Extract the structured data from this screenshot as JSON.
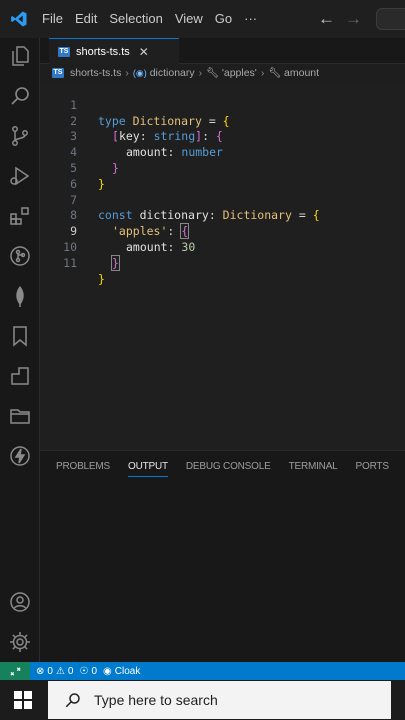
{
  "titlebar": {
    "menu": [
      "File",
      "Edit",
      "Selection",
      "View",
      "Go",
      "···"
    ],
    "back_icon": "arrow-left-icon",
    "forward_icon": "arrow-right-icon"
  },
  "activitybar": {
    "icons": [
      "files-icon",
      "search-icon",
      "source-control-icon",
      "run-debug-icon",
      "extensions-icon",
      "github-icon",
      "mongodb-leaf-icon",
      "bookmark-icon",
      "page-icon",
      "folder-icon",
      "lightning-icon",
      "account-icon",
      "settings-gear-icon"
    ]
  },
  "tab": {
    "label": "shorts-ts.ts",
    "badge": "TS",
    "close": "✕"
  },
  "breadcrumb": {
    "file": "shorts-ts.ts",
    "symbol": "dictionary",
    "key1": "'apples'",
    "key2": "amount"
  },
  "code": {
    "line_numbers": [
      "1",
      "2",
      "3",
      "4",
      "5",
      "6",
      "7",
      "8",
      "9",
      "10",
      "11"
    ],
    "active_line": 9,
    "tokens": {
      "type_kw": "type",
      "dict_type": "Dictionary",
      "eq": " = ",
      "open_brace": "{",
      "close_brace": "}",
      "idx_open": "[",
      "idx_key": "key",
      "idx_colon": ": ",
      "string_kw": "string",
      "idx_close": "]",
      "colon": ": ",
      "amount": "amount",
      "number_kw": "number",
      "const_kw": "const",
      "dict_var": "dictionary",
      "apples": "'apples'",
      "thirty": "30"
    }
  },
  "panel": {
    "tabs": [
      "PROBLEMS",
      "OUTPUT",
      "DEBUG CONSOLE",
      "TERMINAL",
      "PORTS"
    ],
    "active": "OUTPUT"
  },
  "statusbar": {
    "remote_icon": "remote-icon",
    "errors": "0",
    "warnings": "0",
    "ports": "0",
    "cloak": "Cloak"
  },
  "taskbar": {
    "search_placeholder": "Type here to search"
  },
  "colors": {
    "accent": "#007acc",
    "keyword": "#569cd6",
    "type": "#e5c07b",
    "number": "#b5cea8"
  }
}
